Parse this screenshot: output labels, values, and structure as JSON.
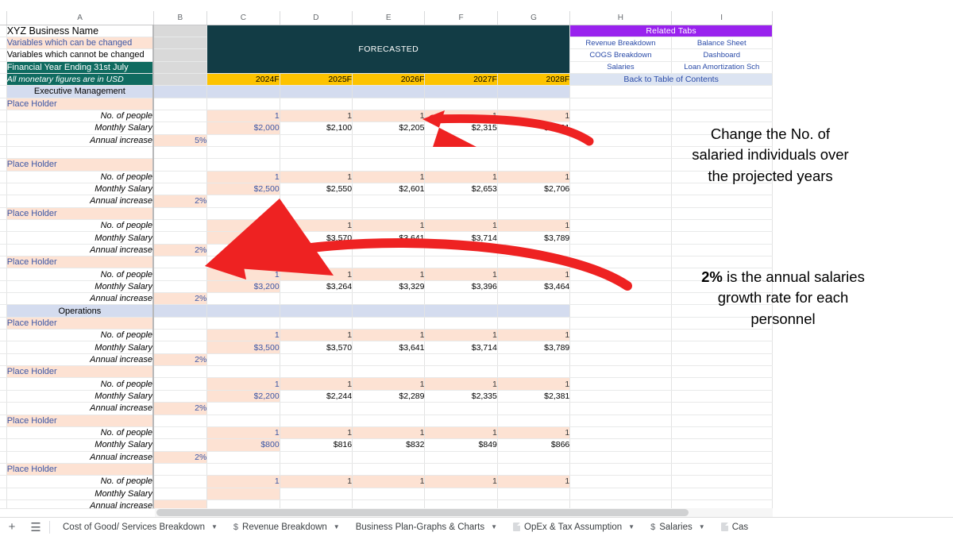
{
  "sheet": {
    "column_headers": [
      "A",
      "B",
      "C",
      "D",
      "E",
      "F",
      "G",
      "H",
      "I"
    ],
    "title": "XYZ Business Name",
    "legend": {
      "can_change": "Variables which can be changed",
      "cannot_change": "Variables which cannot be changed",
      "financial_year": "Financial Year Ending 31st July",
      "currency_note": "All monetary figures are in USD"
    },
    "forecast_banner": "FORECASTED",
    "years": [
      "2024F",
      "2025F",
      "2026F",
      "2027F",
      "2028F"
    ],
    "related_tabs": {
      "header": "Related Tabs",
      "links": [
        [
          "Revenue Breakdown",
          "Balance Sheet"
        ],
        [
          "COGS Breakdown",
          "Dashboard"
        ],
        [
          "Salaries",
          "Loan Amortization Sch"
        ]
      ],
      "back_link": "Back to Table of Contents"
    },
    "row_labels": {
      "people": "No. of people",
      "salary": "Monthly Salary",
      "increase": "Annual increase",
      "placeholder": "Place Holder"
    },
    "sections": [
      {
        "name": "Executive Management",
        "groups": [
          {
            "label": "Place Holder",
            "people": [
              "1",
              "1",
              "1",
              "1",
              "1"
            ],
            "salary": [
              "$2,000",
              "$2,100",
              "$2,205",
              "$2,315",
              "$2,431"
            ],
            "increase": "5%"
          },
          {
            "label": "Place Holder",
            "people": [
              "1",
              "1",
              "1",
              "1",
              "1"
            ],
            "salary": [
              "$2,500",
              "$2,550",
              "$2,601",
              "$2,653",
              "$2,706"
            ],
            "increase": "2%"
          },
          {
            "label": "Place Holder",
            "people": [
              "1",
              "1",
              "1",
              "1",
              "1"
            ],
            "salary": [
              "$3,500",
              "$3,570",
              "$3,641",
              "$3,714",
              "$3,789"
            ],
            "increase": "2%"
          },
          {
            "label": "Place Holder",
            "people": [
              "1",
              "1",
              "1",
              "1",
              "1"
            ],
            "salary": [
              "$3,200",
              "$3,264",
              "$3,329",
              "$3,396",
              "$3,464"
            ],
            "increase": "2%"
          }
        ]
      },
      {
        "name": "Operations",
        "groups": [
          {
            "label": "Place Holder",
            "people": [
              "1",
              "1",
              "1",
              "1",
              "1"
            ],
            "salary": [
              "$3,500",
              "$3,570",
              "$3,641",
              "$3,714",
              "$3,789"
            ],
            "increase": "2%"
          },
          {
            "label": "Place Holder",
            "people": [
              "1",
              "1",
              "1",
              "1",
              "1"
            ],
            "salary": [
              "$2,200",
              "$2,244",
              "$2,289",
              "$2,335",
              "$2,381"
            ],
            "increase": "2%"
          },
          {
            "label": "Place Holder",
            "people": [
              "1",
              "1",
              "1",
              "1",
              "1"
            ],
            "salary": [
              "$800",
              "$816",
              "$832",
              "$849",
              "$866"
            ],
            "increase": "2%"
          },
          {
            "label": "Place Holder",
            "people": [
              "1",
              "1",
              "1",
              "1",
              "1"
            ],
            "salary": [
              "",
              "",
              "",
              "",
              ""
            ],
            "increase": ""
          }
        ]
      }
    ]
  },
  "annotations": [
    {
      "id": "anno1",
      "lines": [
        "Change the No. of",
        "salaried individuals over",
        "the projected years"
      ],
      "arrow_color": "#ee2222"
    },
    {
      "id": "anno2",
      "bold_prefix": "2%",
      "lines": [
        " is the annual salaries",
        "growth rate for each",
        "personnel"
      ],
      "arrow_color": "#ee2222"
    }
  ],
  "tabbar": {
    "add_sheet": "+",
    "all_sheets": "☰",
    "tabs": [
      {
        "label": "Cost of Good/ Services Breakdown",
        "icon": "none"
      },
      {
        "label": "Revenue Breakdown",
        "icon": "dollar"
      },
      {
        "label": "Business Plan-Graphs & Charts",
        "icon": "none"
      },
      {
        "label": "OpEx & Tax Assumption",
        "icon": "doc"
      },
      {
        "label": "Salaries",
        "icon": "dollar"
      },
      {
        "label": "Cas",
        "icon": "doc"
      }
    ]
  },
  "colors": {
    "teal_header": "#123c45",
    "amber_year": "#fdc300",
    "purple_related": "#9922ee",
    "peach_input": "#fde2d3",
    "section_blue": "#d4dcef",
    "green_fy": "#0f6b60",
    "link_blue": "#2a4ba8",
    "arrow_red": "#ee2222"
  }
}
